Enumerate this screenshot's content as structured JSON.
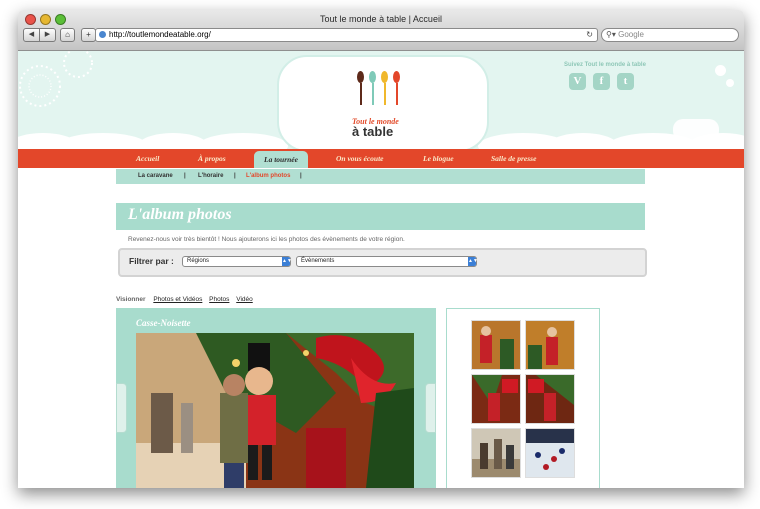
{
  "browser": {
    "window_title": "Tout le monde à table | Accueil",
    "url": "http://toutlemondeatable.org/",
    "search_placeholder": "Google",
    "back_glyph": "◀",
    "forward_glyph": "▶",
    "home_glyph": "⌂",
    "add_glyph": "+",
    "reload_glyph": "↻"
  },
  "header": {
    "logo_line1": "Tout le monde",
    "logo_line2": "à table",
    "follow_text": "Suivez Tout le monde à table",
    "social": [
      {
        "icon": "vimeo-icon",
        "glyph": "V"
      },
      {
        "icon": "facebook-icon",
        "glyph": "f"
      },
      {
        "icon": "twitter-icon",
        "glyph": "t"
      }
    ]
  },
  "nav": {
    "items": [
      "Accueil",
      "À propos",
      "La tournée",
      "On vous écoute",
      "Le blogue",
      "Salle de presse"
    ],
    "active": "La tournée"
  },
  "subnav": {
    "items": [
      "La caravane",
      "L'horaire",
      "L'album photos"
    ],
    "active": "L'album photos",
    "separator": "|"
  },
  "album": {
    "title": "L'album photos",
    "intro": "Revenez-nous voir très bientôt ! Nous ajouterons ici les photos des évènements de votre région.",
    "filter_label": "Filtrer par :",
    "filter_regions": "Régions",
    "filter_events": "Évènements",
    "select_arrow": "▲▼"
  },
  "views": {
    "label": "Visionner",
    "options": [
      "Photos et Vidéos",
      "Photos",
      "Vidéo"
    ]
  },
  "player": {
    "title": "Casse-Noisette"
  },
  "colors": {
    "accent_red": "#e3472a",
    "mint": "#a8dccd",
    "header_bg": "#e3f5f0"
  }
}
